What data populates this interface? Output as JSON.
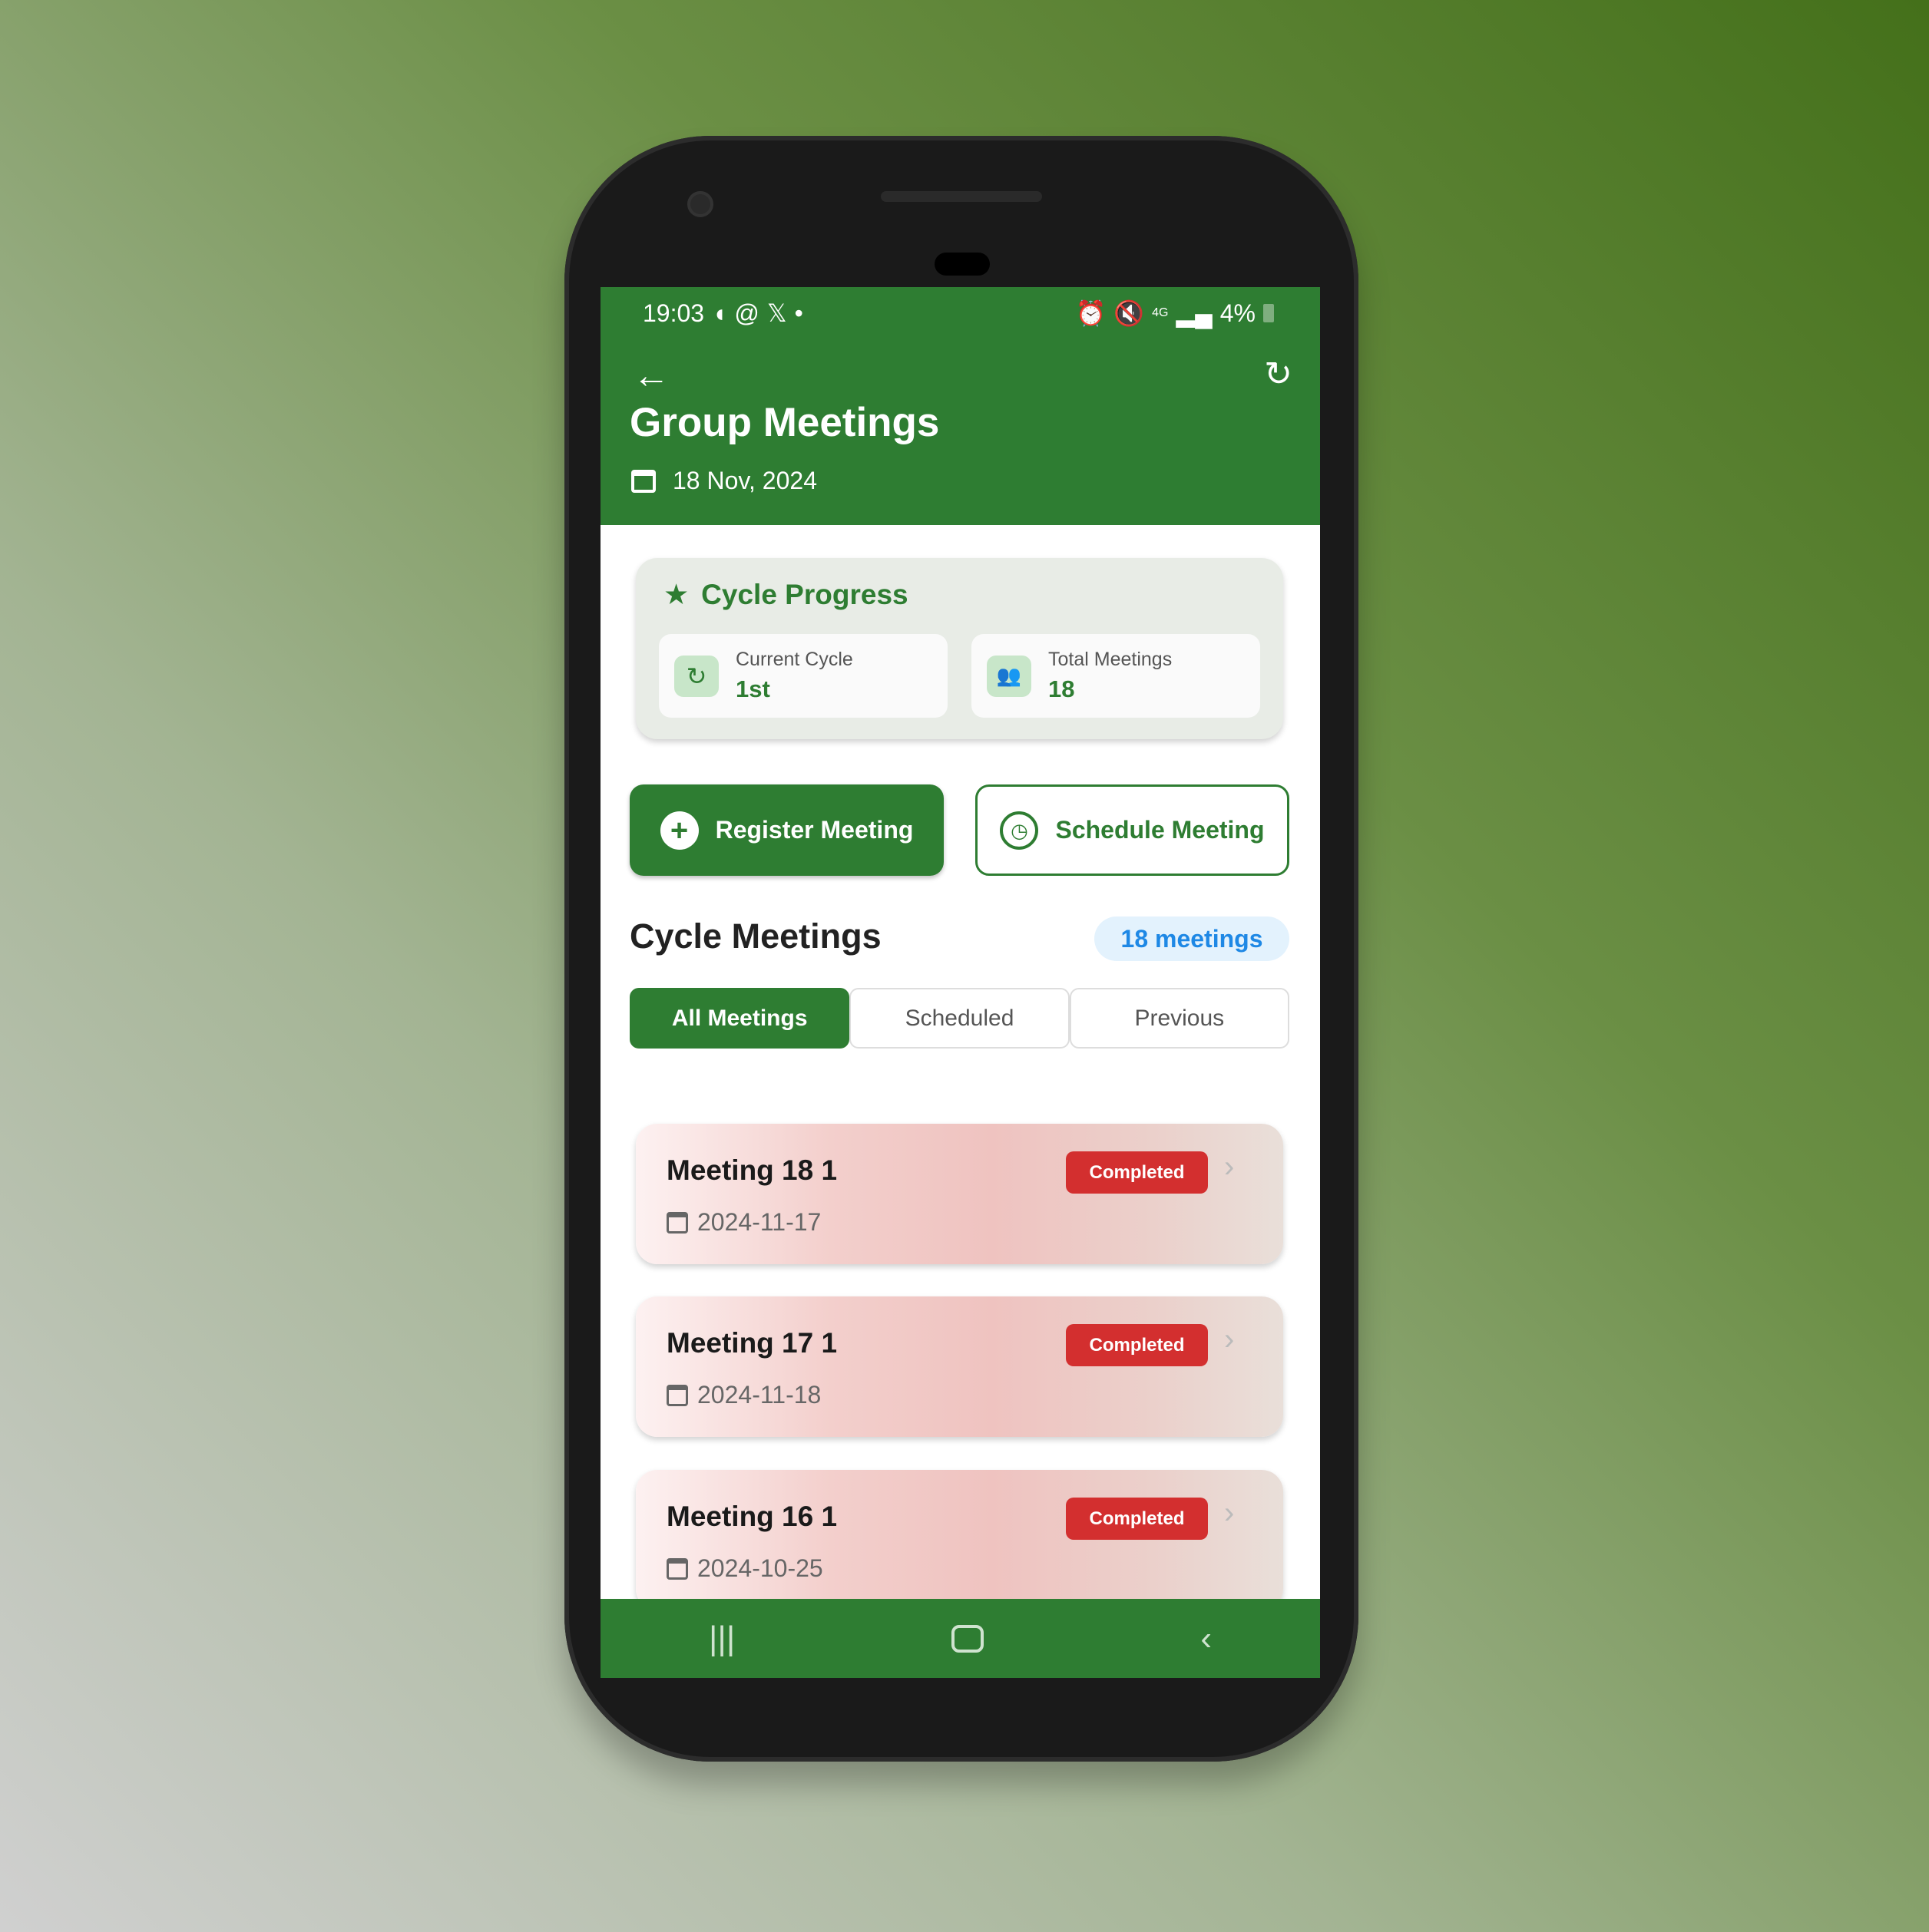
{
  "status_bar": {
    "time": "19:03",
    "left_icons": [
      "bixby-icon",
      "threads-icon",
      "x-icon",
      "dot-icon"
    ],
    "right_icons": [
      "alarm-icon",
      "mute-icon",
      "4g-icon",
      "signal-icon"
    ],
    "battery": "4%"
  },
  "header": {
    "title": "Group Meetings",
    "date": "18 Nov, 2024"
  },
  "cycle_progress": {
    "title": "Cycle Progress",
    "stats": [
      {
        "label": "Current Cycle",
        "value": "1st",
        "icon": "refresh-icon"
      },
      {
        "label": "Total Meetings",
        "value": "18",
        "icon": "group-icon"
      }
    ]
  },
  "actions": {
    "register": "Register Meeting",
    "schedule": "Schedule Meeting"
  },
  "section": {
    "title": "Cycle Meetings",
    "count": "18 meetings"
  },
  "tabs": [
    {
      "label": "All Meetings",
      "active": true
    },
    {
      "label": "Scheduled"
    },
    {
      "label": "Previous"
    }
  ],
  "meetings": [
    {
      "name": "Meeting 18 1",
      "date": "2024-11-17",
      "status": "Completed"
    },
    {
      "name": "Meeting 17 1",
      "date": "2024-11-18",
      "status": "Completed"
    },
    {
      "name": "Meeting 16 1",
      "date": "2024-10-25",
      "status": "Completed"
    }
  ],
  "colors": {
    "primary": "#2e7d32",
    "completed": "#d32f2f",
    "badge_text": "#1e88e5"
  }
}
